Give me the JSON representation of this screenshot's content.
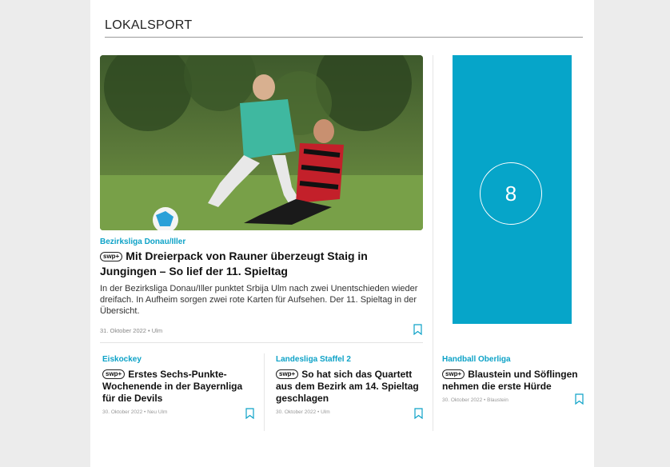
{
  "section": {
    "title": "LOKALSPORT"
  },
  "hero": {
    "kicker": "Bezirksliga Donau/Iller",
    "badge": "swp+",
    "headline": "Mit Dreierpack von Rauner überzeugt Staig in Jungingen – So lief der 11. Spieltag",
    "teaser": "In der Bezirksliga Donau/Iller punktet Srbija Ulm nach zwei Unentschieden wieder dreifach. In Aufheim sorgen zwei rote Karten für Aufsehen. Der 11. Spieltag in der Übersicht.",
    "meta": "31. Oktober 2022 • Ulm"
  },
  "ad": {
    "number": "8",
    "color": "#06a5c9"
  },
  "cards": [
    {
      "kicker": "Eiskockey",
      "badge": "swp+",
      "title": "Erstes Sechs-Punkte-Wochenende in der Bayernliga für die Devils",
      "meta": "30. Oktober 2022 • Neu Ulm"
    },
    {
      "kicker": "Landesliga Staffel 2",
      "badge": "swp+",
      "title": "So hat sich das Quartett aus dem Bezirk am 14. Spieltag geschlagen",
      "meta": "30. Oktober 2022 • Ulm"
    },
    {
      "kicker": "Handball Oberliga",
      "badge": "swp+",
      "title": "Blaustein und Söflingen nehmen die erste Hürde",
      "meta": "30. Oktober 2022 • Blaustein"
    }
  ],
  "colors": {
    "accent": "#0da2c7",
    "background": "#ececec"
  },
  "icons": {
    "bookmark": "bookmark-icon"
  }
}
